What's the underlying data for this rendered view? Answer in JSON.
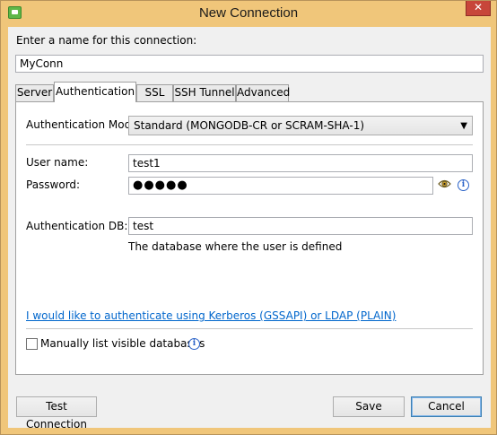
{
  "window": {
    "title": "New Connection",
    "close_glyph": "✕"
  },
  "name_section": {
    "label": "Enter a name for this connection:",
    "value": "MyConn"
  },
  "tabs": [
    {
      "label": "Server"
    },
    {
      "label": "Authentication"
    },
    {
      "label": "SSL"
    },
    {
      "label": "SSH Tunnel"
    },
    {
      "label": "Advanced"
    }
  ],
  "auth": {
    "mode_label": "Authentication Mode:",
    "mode_value": "Standard (MONGODB-CR or SCRAM-SHA-1)",
    "username_label": "User name:",
    "username_value": "test1",
    "password_label": "Password:",
    "password_masked": "●●●●●",
    "authdb_label": "Authentication DB:",
    "authdb_value": "test",
    "authdb_hint": "The database where the user is defined",
    "kerberos_link": "I would like to authenticate using Kerberos (GSSAPI) or LDAP (PLAIN)",
    "manual_db_label": "Manually list visible databases",
    "manual_db_checked": false
  },
  "buttons": {
    "test": "Test Connection",
    "save": "Save",
    "cancel": "Cancel"
  },
  "icons": {
    "eye": "eye-icon",
    "info": "info-icon",
    "app": "app-icon"
  },
  "colors": {
    "titlebar": "#f0c67a",
    "close": "#c7463a",
    "link": "#0066cc",
    "info": "#2a62c8"
  }
}
